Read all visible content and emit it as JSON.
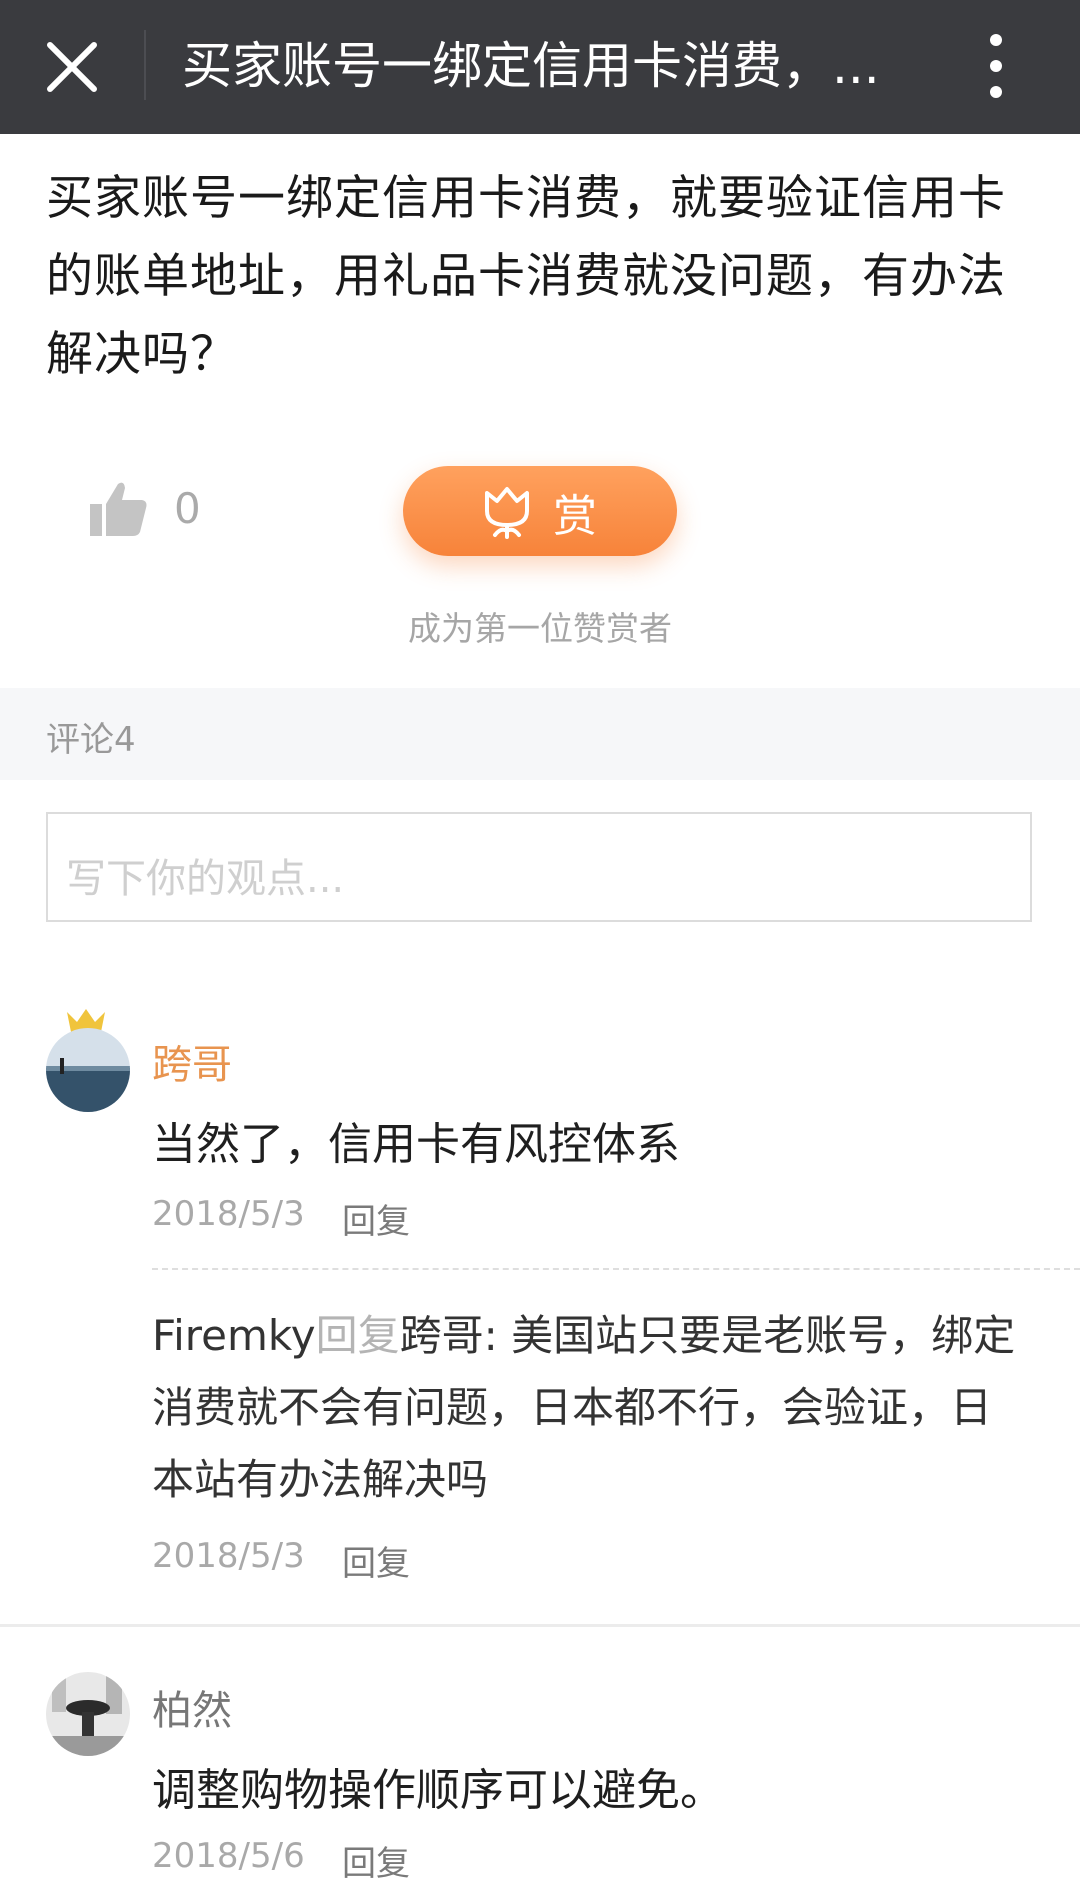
{
  "topbar": {
    "title": "买家账号一绑定信用卡消费，...",
    "close_icon": "close-icon",
    "more_icon": "more-vertical-icon"
  },
  "question": {
    "text": "买家账号一绑定信用卡消费，就要验证信用卡的账单地址，用礼品卡消费就没问题，有办法解决吗？"
  },
  "actions": {
    "like_icon": "thumbs-up-icon",
    "like_count": "0",
    "reward_icon": "tulip-icon",
    "reward_label": "赏",
    "reward_hint": "成为第一位赞赏者"
  },
  "comments": {
    "header": "评论4",
    "input_placeholder": "写下你的观点...",
    "items": [
      {
        "author": "跨哥",
        "badge": "crown-icon",
        "text": "当然了，信用卡有风控体系",
        "date": "2018/5/3",
        "reply_label": "回复",
        "replies": [
          {
            "from": "Firemky",
            "verb": "回复",
            "to": "跨哥:",
            "text": "美国站只要是老账号，绑定消费就不会有问题，日本都不行，会验证，日本站有办法解决吗",
            "date": "2018/5/3",
            "reply_label": "回复"
          }
        ]
      },
      {
        "author": "柏然",
        "text": "调整购物操作顺序可以避免。",
        "date": "2018/5/6",
        "reply_label": "回复"
      }
    ]
  },
  "colors": {
    "topbar_bg": "#3a3b3f",
    "accent_orange": "#f7833a",
    "author_highlight": "#e8944f",
    "crown_gold": "#f0c43c"
  }
}
